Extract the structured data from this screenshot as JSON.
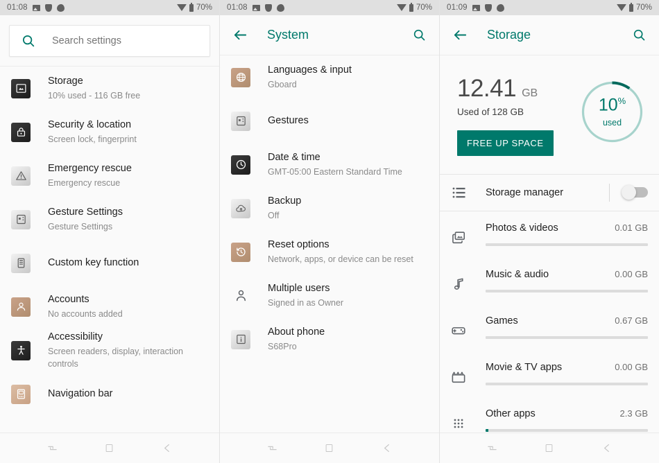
{
  "status_bar": {
    "time_left": "01:08",
    "time_right": "01:09",
    "battery_pct": "70%",
    "icons": [
      "image-icon",
      "shield-icon",
      "droplet-icon",
      "wifi-icon",
      "battery-icon"
    ]
  },
  "colors": {
    "accent_teal": "#00796b",
    "ring_track": "#a7d3cc",
    "status_bg": "#e0e0e0",
    "page_bg": "#fafafa",
    "bar_track": "#dcdcdc"
  },
  "panel_settings": {
    "search": {
      "placeholder": "Search settings",
      "icon": "search-icon"
    },
    "items": [
      {
        "title": "Storage",
        "subtitle": "10% used - 116 GB free",
        "icon": "storage-icon",
        "icon_style": "ic-dark"
      },
      {
        "title": "Security & location",
        "subtitle": "Screen lock, fingerprint",
        "icon": "lock-icon",
        "icon_style": "ic-dark"
      },
      {
        "title": "Emergency rescue",
        "subtitle": "Emergency rescue",
        "icon": "warning-icon",
        "icon_style": "ic-grey"
      },
      {
        "title": "Gesture Settings",
        "subtitle": "Gesture Settings",
        "icon": "gesture-icon",
        "icon_style": "ic-grey"
      },
      {
        "title": "Custom key function",
        "subtitle": "",
        "icon": "phone-key-icon",
        "icon_style": "ic-grey"
      },
      {
        "title": "Accounts",
        "subtitle": "No accounts added",
        "icon": "account-icon",
        "icon_style": "ic-tan"
      },
      {
        "title": "Accessibility",
        "subtitle": "Screen readers, display, interaction controls",
        "icon": "accessibility-icon",
        "icon_style": "ic-dark"
      },
      {
        "title": "Navigation bar",
        "subtitle": "",
        "icon": "navbar-icon",
        "icon_style": "ic-tanlt"
      }
    ]
  },
  "panel_system": {
    "title": "System",
    "back_icon": "back-arrow-icon",
    "search_icon": "search-icon",
    "items": [
      {
        "title": "Languages & input",
        "subtitle": "Gboard",
        "icon": "globe-icon",
        "icon_style": "ic-tan"
      },
      {
        "title": "Gestures",
        "subtitle": "",
        "icon": "gesture-icon",
        "icon_style": "ic-grey"
      },
      {
        "title": "Date & time",
        "subtitle": "GMT-05:00 Eastern Standard Time",
        "icon": "clock-icon",
        "icon_style": "ic-dark"
      },
      {
        "title": "Backup",
        "subtitle": "Off",
        "icon": "cloud-upload-icon",
        "icon_style": "ic-grey"
      },
      {
        "title": "Reset options",
        "subtitle": "Network, apps, or device can be reset",
        "icon": "history-icon",
        "icon_style": "ic-tan"
      },
      {
        "title": "Multiple users",
        "subtitle": "Signed in as Owner",
        "icon": "person-icon",
        "icon_style": "ic-none"
      },
      {
        "title": "About phone",
        "subtitle": "S68Pro",
        "icon": "info-icon",
        "icon_style": "ic-grey"
      }
    ]
  },
  "panel_storage": {
    "title": "Storage",
    "back_icon": "back-arrow-icon",
    "search_icon": "search-icon",
    "summary": {
      "used_value": "12.41",
      "used_unit": "GB",
      "used_of": "Used of 128 GB",
      "free_up_label": "FREE UP SPACE",
      "ring_percent": "10",
      "ring_percent_symbol": "%",
      "ring_caption": "used",
      "ring_fill_fraction": 0.1
    },
    "manager": {
      "label": "Storage manager",
      "icon": "list-icon",
      "toggle_state": "off"
    },
    "categories": [
      {
        "name": "Photos & videos",
        "size": "0.01 GB",
        "icon": "photos-icon",
        "fill": 0.0
      },
      {
        "name": "Music & audio",
        "size": "0.00 GB",
        "icon": "music-note-icon",
        "fill": 0.0
      },
      {
        "name": "Games",
        "size": "0.67 GB",
        "icon": "gamepad-icon",
        "fill": 0.0
      },
      {
        "name": "Movie & TV apps",
        "size": "0.00 GB",
        "icon": "movie-clapper-icon",
        "fill": 0.0
      },
      {
        "name": "Other apps",
        "size": "2.3 GB",
        "icon": "apps-grid-icon",
        "fill": 0.016
      }
    ]
  },
  "nav_bar": {
    "buttons": [
      {
        "name": "recents-button",
        "icon": "recents-icon"
      },
      {
        "name": "home-button",
        "icon": "home-square-icon"
      },
      {
        "name": "back-button",
        "icon": "back-arrow-icon"
      }
    ]
  }
}
